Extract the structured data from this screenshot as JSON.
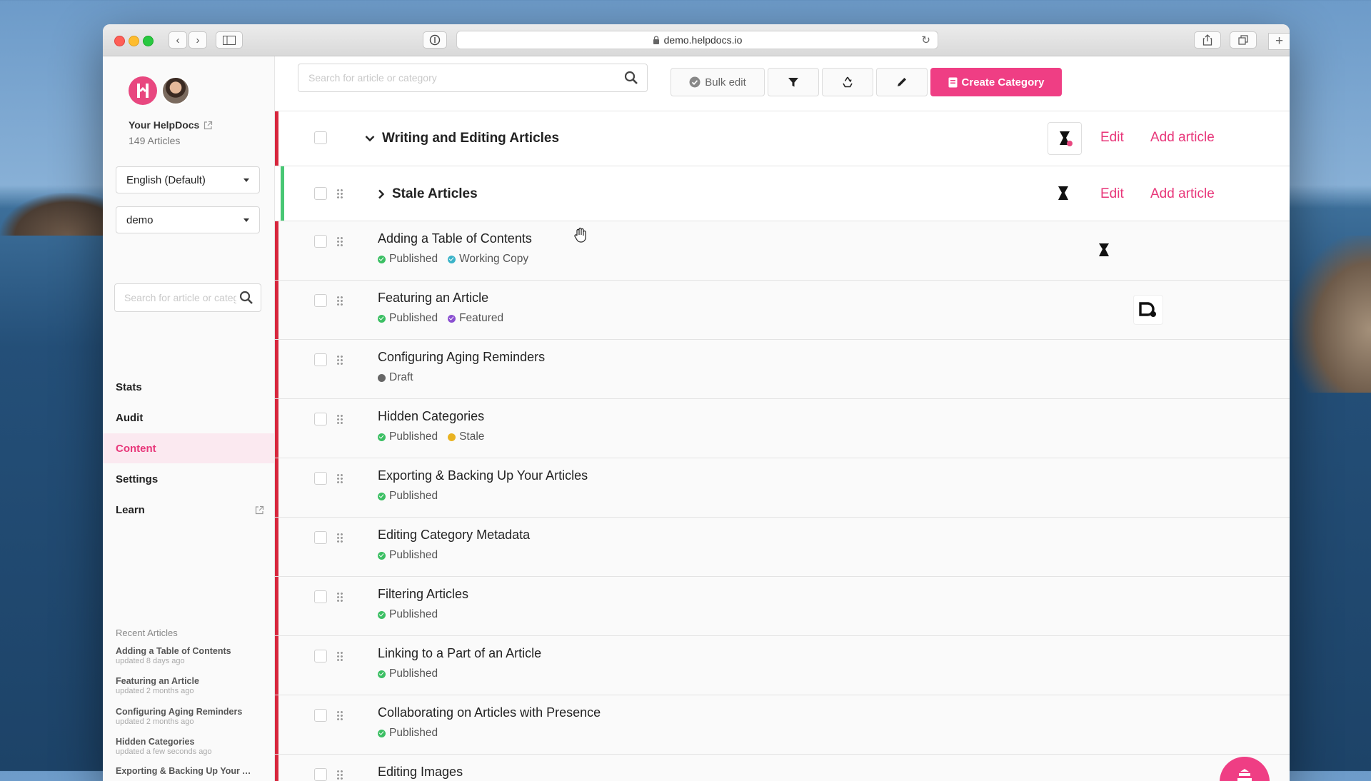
{
  "browser": {
    "url": "demo.helpdocs.io"
  },
  "sidebar": {
    "site_name": "Your HelpDocs",
    "article_count": "149 Articles",
    "language": "English (Default)",
    "project": "demo",
    "search_placeholder": "Search for article or category",
    "nav": [
      {
        "label": "Stats"
      },
      {
        "label": "Audit"
      },
      {
        "label": "Content"
      },
      {
        "label": "Settings"
      },
      {
        "label": "Learn"
      }
    ],
    "recent_heading": "Recent Articles",
    "recent": [
      {
        "title": "Adding a Table of Contents",
        "updated": "updated 8 days ago"
      },
      {
        "title": "Featuring an Article",
        "updated": "updated 2 months ago"
      },
      {
        "title": "Configuring Aging Reminders",
        "updated": "updated 2 months ago"
      },
      {
        "title": "Hidden Categories",
        "updated": "updated a few seconds ago"
      },
      {
        "title": "Exporting & Backing Up Your Articles",
        "updated": ""
      }
    ]
  },
  "toolbar": {
    "search_placeholder": "Search for article or category",
    "bulk_edit": "Bulk edit",
    "create_category": "Create Category"
  },
  "category": {
    "title": "Writing and Editing Articles",
    "edit": "Edit",
    "add_article": "Add article"
  },
  "subcategory": {
    "title": "Stale Articles",
    "edit": "Edit",
    "add_article": "Add article"
  },
  "articles": [
    {
      "title": "Adding a Table of Contents",
      "statuses": [
        {
          "label": "Published"
        },
        {
          "label": "Working Copy"
        }
      ]
    },
    {
      "title": "Featuring an Article",
      "statuses": [
        {
          "label": "Published"
        },
        {
          "label": "Featured"
        }
      ]
    },
    {
      "title": "Configuring Aging Reminders",
      "statuses": [
        {
          "label": "Draft"
        }
      ]
    },
    {
      "title": "Hidden Categories",
      "statuses": [
        {
          "label": "Published"
        },
        {
          "label": "Stale"
        }
      ]
    },
    {
      "title": "Exporting & Backing Up Your Articles",
      "statuses": [
        {
          "label": "Published"
        }
      ]
    },
    {
      "title": "Editing Category Metadata",
      "statuses": [
        {
          "label": "Published"
        }
      ]
    },
    {
      "title": "Filtering Articles",
      "statuses": [
        {
          "label": "Published"
        }
      ]
    },
    {
      "title": "Linking to a Part of an Article",
      "statuses": [
        {
          "label": "Published"
        }
      ]
    },
    {
      "title": "Collaborating on Articles with Presence",
      "statuses": [
        {
          "label": "Published"
        }
      ]
    },
    {
      "title": "Editing Images",
      "statuses": []
    }
  ],
  "colors": {
    "accent": "#ef3e84",
    "category_bar": "#d7263d",
    "stale_bar": "#48c774",
    "published": "#3bbf63",
    "working_copy": "#3bb3c8",
    "featured": "#8a4fd1",
    "draft": "#666666",
    "stale": "#e9b322"
  }
}
